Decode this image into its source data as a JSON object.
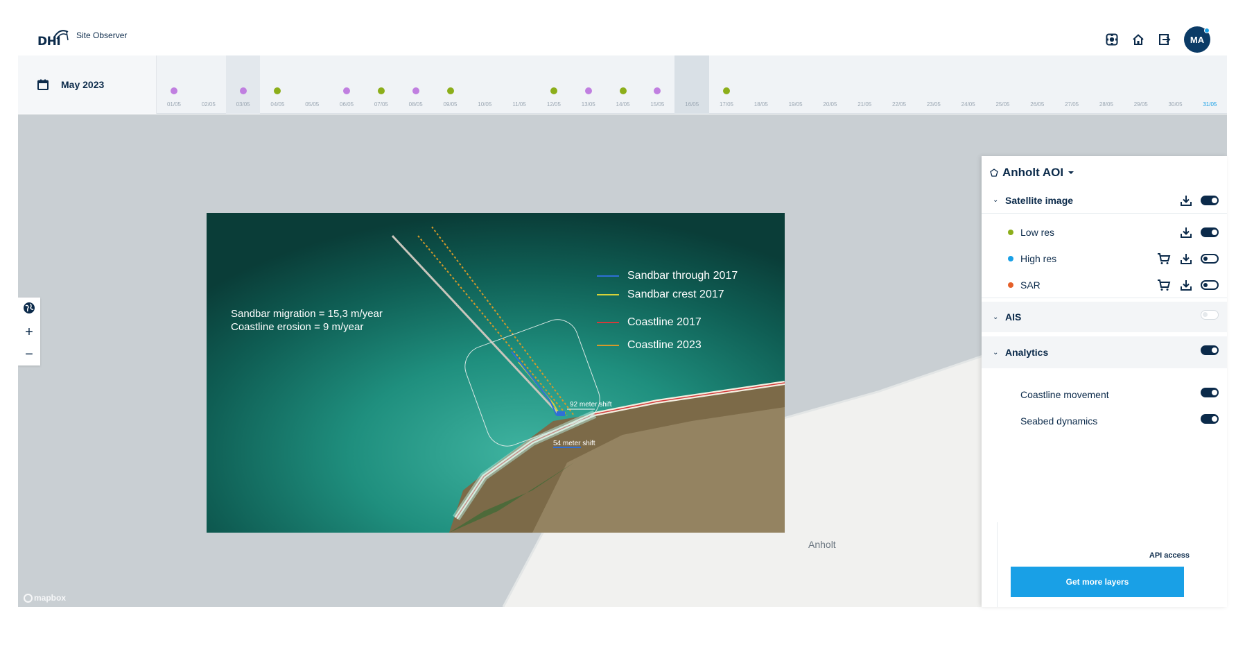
{
  "app": {
    "logo_text": "DHI",
    "title": "Site Observer"
  },
  "header": {
    "icons": [
      "focus-icon",
      "home-icon",
      "logout-icon"
    ],
    "avatar_initials": "MA"
  },
  "timeline": {
    "month_label": "May 2023",
    "days": [
      {
        "label": "01/05",
        "dot": "#c07fe0"
      },
      {
        "label": "02/05",
        "dot": ""
      },
      {
        "label": "03/05",
        "dot": "#c07fe0",
        "state": "sel"
      },
      {
        "label": "04/05",
        "dot": "#8cae1a"
      },
      {
        "label": "05/05",
        "dot": ""
      },
      {
        "label": "06/05",
        "dot": "#c07fe0"
      },
      {
        "label": "07/05",
        "dot": "#8cae1a"
      },
      {
        "label": "08/05",
        "dot": "#c07fe0"
      },
      {
        "label": "09/05",
        "dot": "#8cae1a"
      },
      {
        "label": "10/05",
        "dot": ""
      },
      {
        "label": "11/05",
        "dot": ""
      },
      {
        "label": "12/05",
        "dot": "#8cae1a"
      },
      {
        "label": "13/05",
        "dot": "#c07fe0"
      },
      {
        "label": "14/05",
        "dot": "#8cae1a"
      },
      {
        "label": "15/05",
        "dot": "#c07fe0"
      },
      {
        "label": "16/05",
        "dot": "",
        "state": "cur"
      },
      {
        "label": "17/05",
        "dot": "#8cae1a"
      },
      {
        "label": "18/05",
        "dot": ""
      },
      {
        "label": "19/05",
        "dot": ""
      },
      {
        "label": "20/05",
        "dot": ""
      },
      {
        "label": "21/05",
        "dot": ""
      },
      {
        "label": "22/05",
        "dot": ""
      },
      {
        "label": "23/05",
        "dot": ""
      },
      {
        "label": "24/05",
        "dot": ""
      },
      {
        "label": "25/05",
        "dot": ""
      },
      {
        "label": "26/05",
        "dot": ""
      },
      {
        "label": "27/05",
        "dot": ""
      },
      {
        "label": "28/05",
        "dot": ""
      },
      {
        "label": "29/05",
        "dot": ""
      },
      {
        "label": "30/05",
        "dot": ""
      },
      {
        "label": "31/05",
        "dot": "",
        "state": "last"
      }
    ]
  },
  "map": {
    "attribution": "mapbox",
    "place_label": "Anholt",
    "overlay": {
      "annotation_line1": "Sandbar migration = 15,3 m/year",
      "annotation_line2": "Coastline erosion = 9 m/year",
      "legend": [
        {
          "label": "Sandbar through 2017",
          "color": "#2f6fd6"
        },
        {
          "label": "Sandbar crest 2017",
          "color": "#d5d23a"
        },
        {
          "label": "Coastline 2017",
          "color": "#d23b3b"
        },
        {
          "label": "Coastline 2023",
          "color": "#d59a2a"
        }
      ],
      "shift_label_1": "92 meter shift",
      "shift_label_2": "54 meter shift"
    }
  },
  "panel": {
    "aoi_title": "Anholt AOI",
    "satellite_title": "Satellite image",
    "layers": [
      {
        "label": "Low res",
        "color": "#8cae1a",
        "cart": false,
        "toggle": "on"
      },
      {
        "label": "High res",
        "color": "#19a0e6",
        "cart": true,
        "toggle": "off"
      },
      {
        "label": "SAR",
        "color": "#e5602a",
        "cart": true,
        "toggle": "off"
      }
    ],
    "ais_title": "AIS",
    "analytics_title": "Analytics",
    "analytics_items": [
      "Coastline movement",
      "Seabed dynamics"
    ],
    "api_label": "API access",
    "cta_label": "Get more layers"
  },
  "colors": {
    "brand": "#0b2a4a",
    "accent": "#19a0e6",
    "map_water": "#c9cfd3"
  }
}
